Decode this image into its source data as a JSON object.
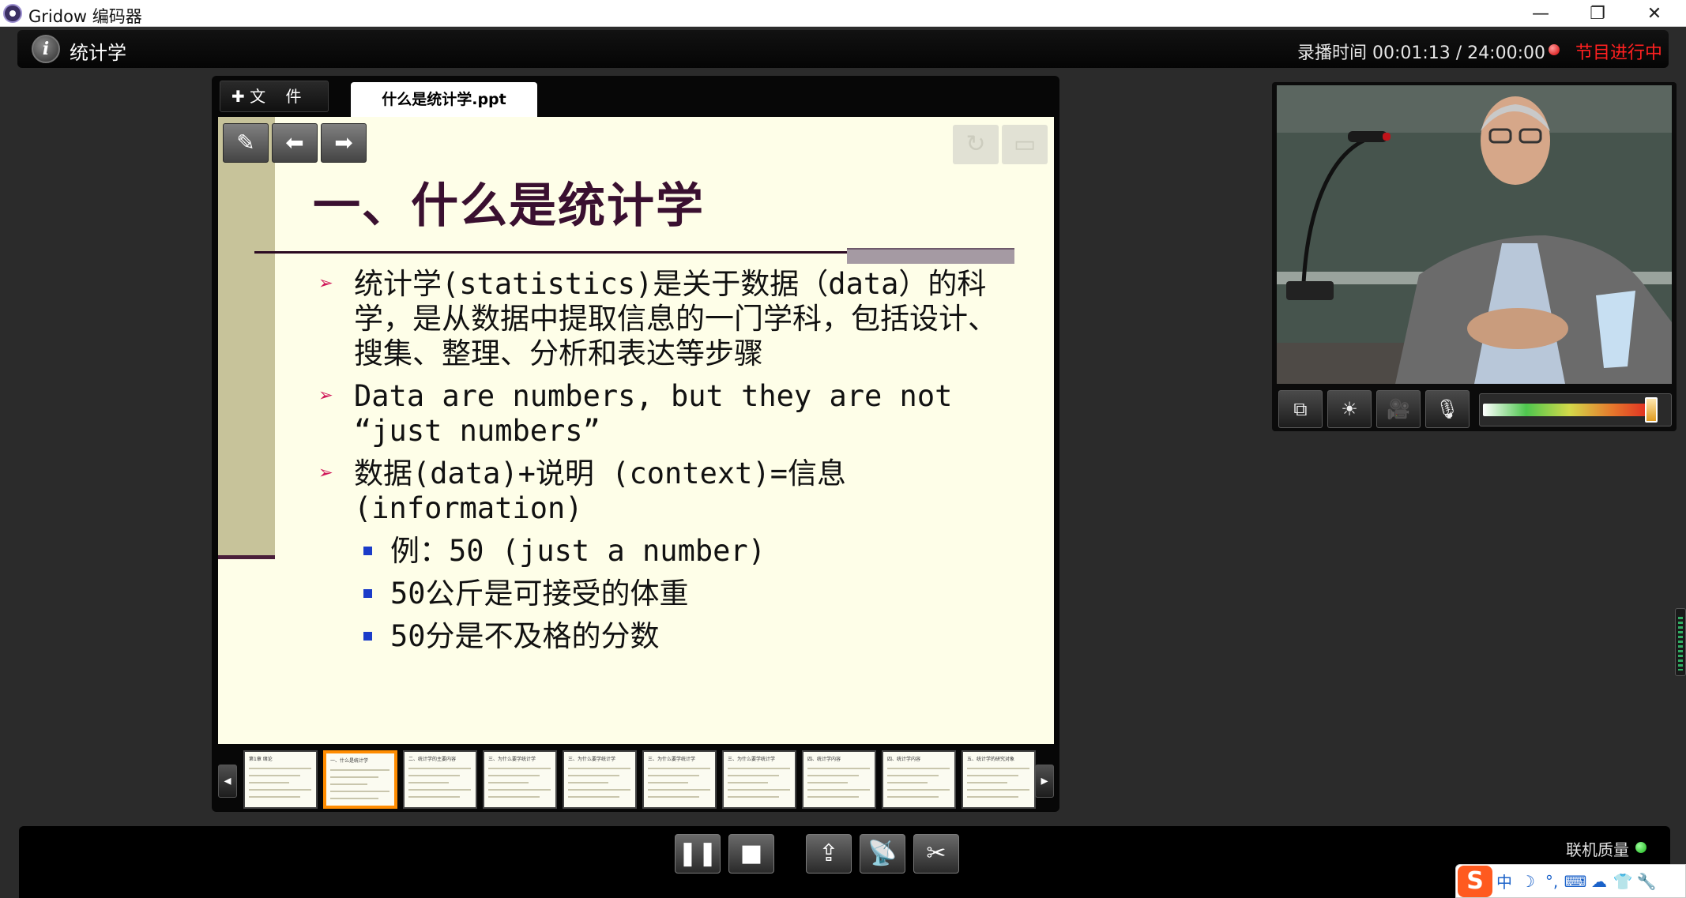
{
  "window": {
    "title": "Gridow 编码器",
    "minimize_icon": "minimize-icon",
    "restore_icon": "restore-icon",
    "close_icon": "close-icon"
  },
  "program": {
    "title": "统计学",
    "recording_time": "录播时间 00:01:13  / 24:00:00",
    "status": "节目进行中"
  },
  "presentation": {
    "file_button": "✚ 文    件",
    "document_tab": "什么是统计学.ppt",
    "slide": {
      "title": "一、什么是统计学",
      "bullets": [
        "统计学(statistics)是关于数据（data）的科学，是从数据中提取信息的一门学科，包括设计、搜集、整理、分析和表达等步骤",
        "Data are numbers, but they are not “just numbers”",
        "数据(data)+说明 (context)=信息(information)"
      ],
      "sub_bullets": [
        "例：50 (just a number)",
        "50公斤是可接受的体重",
        "50分是不及格的分数"
      ]
    },
    "thumbnails": [
      {
        "title": "第1章 绪论",
        "active": false
      },
      {
        "title": "一、什么是统计学",
        "active": true
      },
      {
        "title": "二、统计学的主要内容",
        "active": false
      },
      {
        "title": "三、为什么要学统计学",
        "active": false
      },
      {
        "title": "三、为什么要学统计学",
        "active": false
      },
      {
        "title": "三、为什么要学统计学",
        "active": false
      },
      {
        "title": "三、为什么要学统计学",
        "active": false
      },
      {
        "title": "四、统计学内容",
        "active": false
      },
      {
        "title": "四、统计学内容",
        "active": false
      },
      {
        "title": "五、统计学的研究对象",
        "active": false
      }
    ]
  },
  "camera": {
    "mic_level": 0.93
  },
  "status_bar": {
    "quality_label": "联机质量"
  },
  "ime": {
    "items": [
      "中",
      "☽",
      "°,",
      "⌨",
      "☁",
      "👕",
      "🔧"
    ]
  },
  "colors": {
    "status_red": "#ff2020",
    "slide_bg": "#fefee8",
    "title_purple": "#3a1030",
    "arrow_pink": "#d0185a",
    "active_thumb": "#ff8c00",
    "quality_ok": "#18b418"
  }
}
